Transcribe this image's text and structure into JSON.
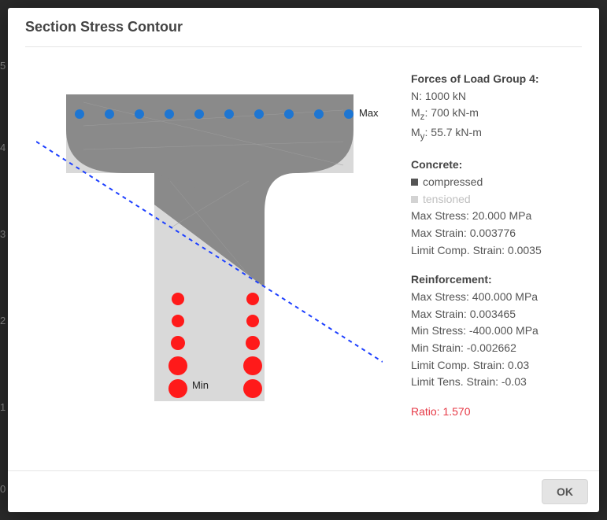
{
  "dialog": {
    "title": "Section Stress Contour",
    "ok_label": "OK"
  },
  "axis_ticks": [
    "5",
    "4",
    "3",
    "2",
    "1",
    "0"
  ],
  "diagram": {
    "max_label": "Max",
    "min_label": "Min",
    "neutral_axis_color": "#1e40ff",
    "compressed_color": "#8a8a8a",
    "tensioned_color": "#d9d9d9",
    "rebar_top_color": "#1e76d2",
    "rebar_bot_color": "#ff1a1a"
  },
  "forces": {
    "title": "Forces of Load Group 4:",
    "N": "N: 1000 kN",
    "Mz_label": "M",
    "Mz_sub": "z",
    "Mz_val": ": 700 kN-m",
    "My_label": "M",
    "My_sub": "y",
    "My_val": ": 55.7 kN-m"
  },
  "concrete": {
    "title": "Concrete:",
    "compressed_label": "compressed",
    "tensioned_label": "tensioned",
    "max_stress": "Max Stress: 20.000 MPa",
    "max_strain": "Max Strain: 0.003776",
    "limit_comp": "Limit Comp. Strain: 0.0035"
  },
  "reinforcement": {
    "title": "Reinforcement:",
    "max_stress": "Max Stress: 400.000 MPa",
    "max_strain": "Max Strain: 0.003465",
    "min_stress": "Min Stress: -400.000 MPa",
    "min_strain": "Min Strain: -0.002662",
    "limit_comp": "Limit Comp. Strain: 0.03",
    "limit_tens": "Limit Tens. Strain: -0.03"
  },
  "ratio": "Ratio: 1.570"
}
